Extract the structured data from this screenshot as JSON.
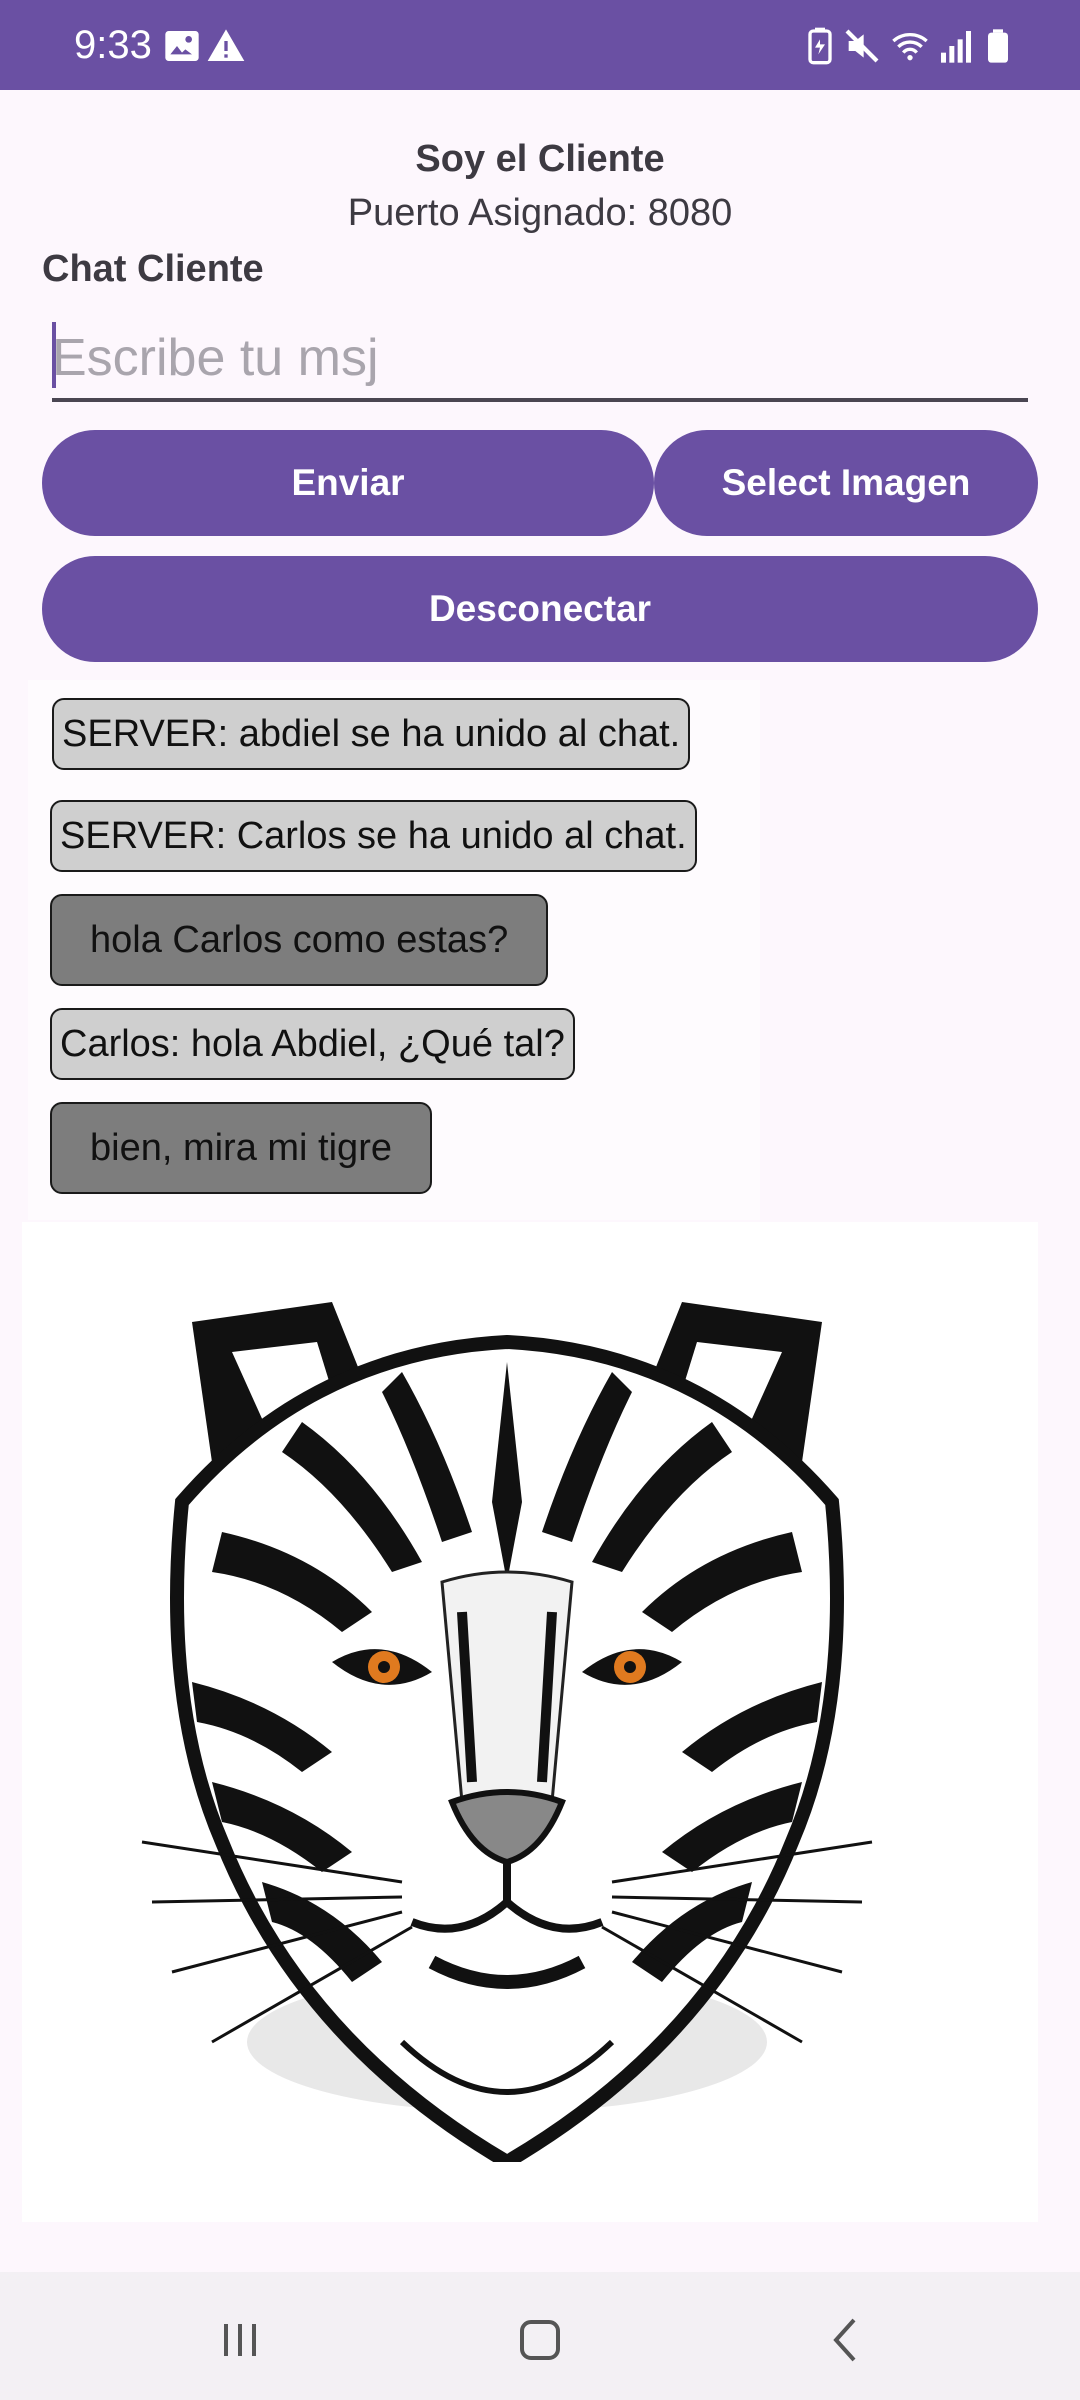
{
  "status_bar": {
    "time": "9:33",
    "left_icons": [
      "image-icon",
      "warning-icon"
    ],
    "right_icons": [
      "battery-saver-icon",
      "mute-icon",
      "wifi-icon",
      "signal-icon",
      "battery-icon"
    ],
    "background": "#6a50a3"
  },
  "header": {
    "role_title": "Soy el Cliente",
    "port_text": "Puerto Asignado: 8080"
  },
  "chat": {
    "title": "Chat Cliente",
    "input": {
      "value": "",
      "placeholder": "Escribe tu msj"
    },
    "buttons": {
      "send": "Enviar",
      "select_image": "Select Imagen",
      "disconnect": "Desconectar"
    },
    "messages": [
      {
        "type": "incoming",
        "text": "SERVER: abdiel se ha unido al chat."
      },
      {
        "type": "incoming",
        "text": "SERVER: Carlos se ha unido al chat."
      },
      {
        "type": "outgoing",
        "text": "hola Carlos como estas?"
      },
      {
        "type": "incoming",
        "text": "Carlos: hola Abdiel, ¿Qué tal?"
      },
      {
        "type": "outgoing",
        "text": "bien, mira mi tigre"
      }
    ],
    "image_message": "tiger-image"
  },
  "nav_bar": {
    "buttons": [
      "recent-apps-icon",
      "home-icon",
      "back-icon"
    ]
  },
  "colors": {
    "primary": "#6a50a3",
    "incoming_bubble": "#cfcfcf",
    "outgoing_bubble": "#7d7d7d",
    "background": "#fdf7fd"
  }
}
